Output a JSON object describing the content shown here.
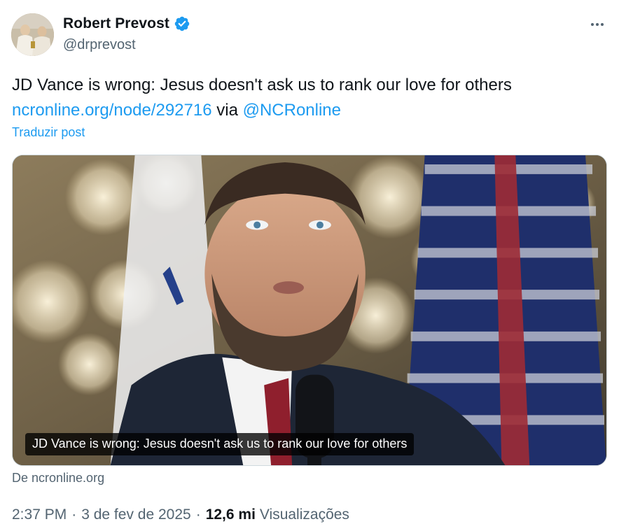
{
  "author": {
    "display_name": "Robert Prevost",
    "handle": "@drprevost",
    "verified": true,
    "avatar_icon": "profile-photo"
  },
  "menu": {
    "icon": "more-options-icon"
  },
  "post": {
    "text": "JD Vance is wrong: Jesus doesn't ask us to rank our love for others",
    "link_text": "ncronline.org/node/292716",
    "via_text": " via ",
    "mention": "@NCRonline",
    "translate_label": "Traduzir post"
  },
  "card": {
    "caption": "JD Vance is wrong: Jesus doesn't ask us to rank our love for others",
    "source": "De ncronline.org"
  },
  "meta": {
    "time": "2:37 PM",
    "separator": "·",
    "date": "3 de fev de 2025",
    "views_count": "12,6 mi",
    "views_label": "Visualizações"
  },
  "colors": {
    "accent": "#1d9bf0",
    "text_primary": "#0f1419",
    "text_secondary": "#536471",
    "border": "#cfd9de"
  }
}
